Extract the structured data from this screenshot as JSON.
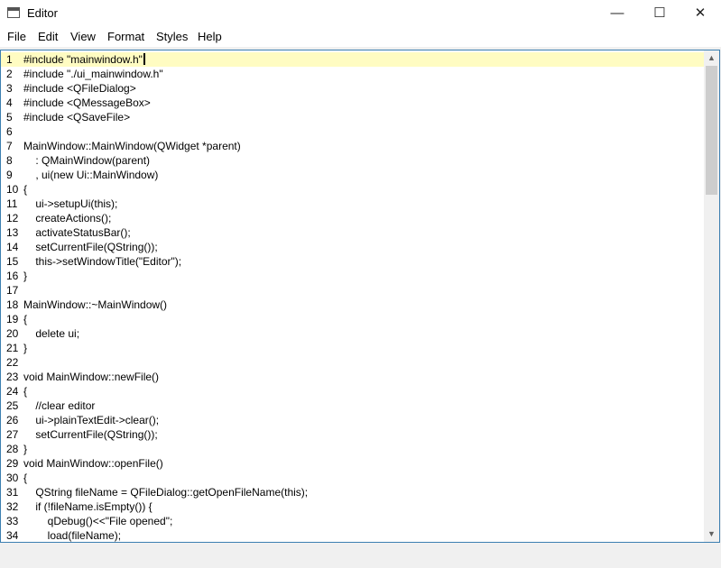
{
  "window": {
    "title": "Editor"
  },
  "window_controls": {
    "minimize": "—",
    "maximize": "☐",
    "close": "✕"
  },
  "menu": [
    "File",
    "Edit",
    "Format",
    "Styles",
    "Help"
  ],
  "menu_view": "View",
  "editor": {
    "current_line": 1,
    "lines": [
      "#include \"mainwindow.h\"",
      "#include \"./ui_mainwindow.h\"",
      "#include <QFileDialog>",
      "#include <QMessageBox>",
      "#include <QSaveFile>",
      "",
      "MainWindow::MainWindow(QWidget *parent)",
      "    : QMainWindow(parent)",
      "    , ui(new Ui::MainWindow)",
      "{",
      "    ui->setupUi(this);",
      "    createActions();",
      "    activateStatusBar();",
      "    setCurrentFile(QString());",
      "    this->setWindowTitle(\"Editor\");",
      "}",
      "",
      "MainWindow::~MainWindow()",
      "{",
      "    delete ui;",
      "}",
      "",
      "void MainWindow::newFile()",
      "{",
      "    //clear editor",
      "    ui->plainTextEdit->clear();",
      "    setCurrentFile(QString());",
      "}",
      "void MainWindow::openFile()",
      "{",
      "    QString fileName = QFileDialog::getOpenFileName(this);",
      "    if (!fileName.isEmpty()) {",
      "        qDebug()<<\"File opened\";",
      "        load(fileName);"
    ]
  },
  "scrollbar": {
    "up": "▲",
    "down": "▼"
  }
}
